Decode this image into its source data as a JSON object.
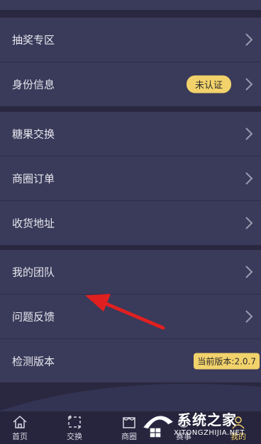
{
  "groups": [
    {
      "items": [
        {
          "label": "抽奖专区",
          "badge": ""
        },
        {
          "label": "身份信息",
          "badge": "未认证"
        }
      ]
    },
    {
      "items": [
        {
          "label": "糖果交换"
        },
        {
          "label": "商圈订单"
        },
        {
          "label": "收货地址"
        }
      ]
    },
    {
      "items": [
        {
          "label": "我的团队"
        },
        {
          "label": "问题反馈"
        },
        {
          "label": "检测版本",
          "badge": "当前版本:2.0.7"
        }
      ]
    }
  ],
  "tabbar": {
    "tabs": [
      {
        "label": "首页",
        "icon": "home-icon"
      },
      {
        "label": "交换",
        "icon": "swap-icon"
      },
      {
        "label": "商圈",
        "icon": "shop-icon"
      },
      {
        "label": "赛事",
        "icon": "match-icon"
      },
      {
        "label": "我的",
        "icon": "user-icon"
      }
    ],
    "active_index": 4
  },
  "watermark": {
    "brand": "系统之家",
    "url": "XITONGZHIJIA.NET"
  },
  "colors": {
    "background": "#2a2840",
    "row": "#3a3a5a",
    "badge": "#f2d26b",
    "arrow": "#e02020"
  }
}
